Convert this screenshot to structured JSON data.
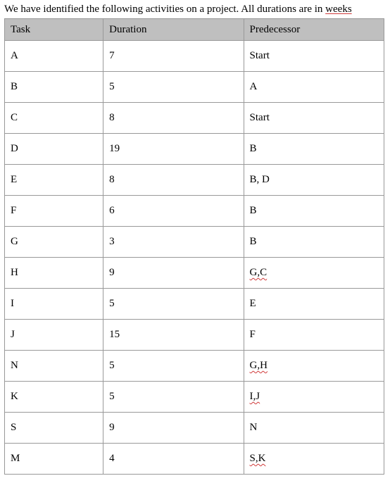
{
  "intro_prefix": "We have identified the following activities on a project. All durations are in ",
  "intro_underlined": "weeks",
  "headers": {
    "task": "Task",
    "duration": "Duration",
    "predecessor": "Predecessor"
  },
  "rows": [
    {
      "task": "A",
      "duration": "7",
      "predecessor": "Start",
      "squiggle": false
    },
    {
      "task": "B",
      "duration": "5",
      "predecessor": "A",
      "squiggle": false
    },
    {
      "task": "C",
      "duration": "8",
      "predecessor": "Start",
      "squiggle": false
    },
    {
      "task": "D",
      "duration": "19",
      "predecessor": "B",
      "squiggle": false
    },
    {
      "task": "E",
      "duration": "8",
      "predecessor": "B, D",
      "squiggle": false
    },
    {
      "task": "F",
      "duration": "6",
      "predecessor": "B",
      "squiggle": false
    },
    {
      "task": "G",
      "duration": "3",
      "predecessor": "B",
      "squiggle": false
    },
    {
      "task": "H",
      "duration": "9",
      "predecessor": "G,C",
      "squiggle": true
    },
    {
      "task": "I",
      "duration": "5",
      "predecessor": "E",
      "squiggle": false
    },
    {
      "task": "J",
      "duration": "15",
      "predecessor": "F",
      "squiggle": false
    },
    {
      "task": "N",
      "duration": "5",
      "predecessor": "G,H",
      "squiggle": true
    },
    {
      "task": "K",
      "duration": "5",
      "predecessor": "I,J",
      "squiggle": true
    },
    {
      "task": "S",
      "duration": "9",
      "predecessor": "N",
      "squiggle": false
    },
    {
      "task": "M",
      "duration": "4",
      "predecessor": "S,K",
      "squiggle": true
    }
  ]
}
